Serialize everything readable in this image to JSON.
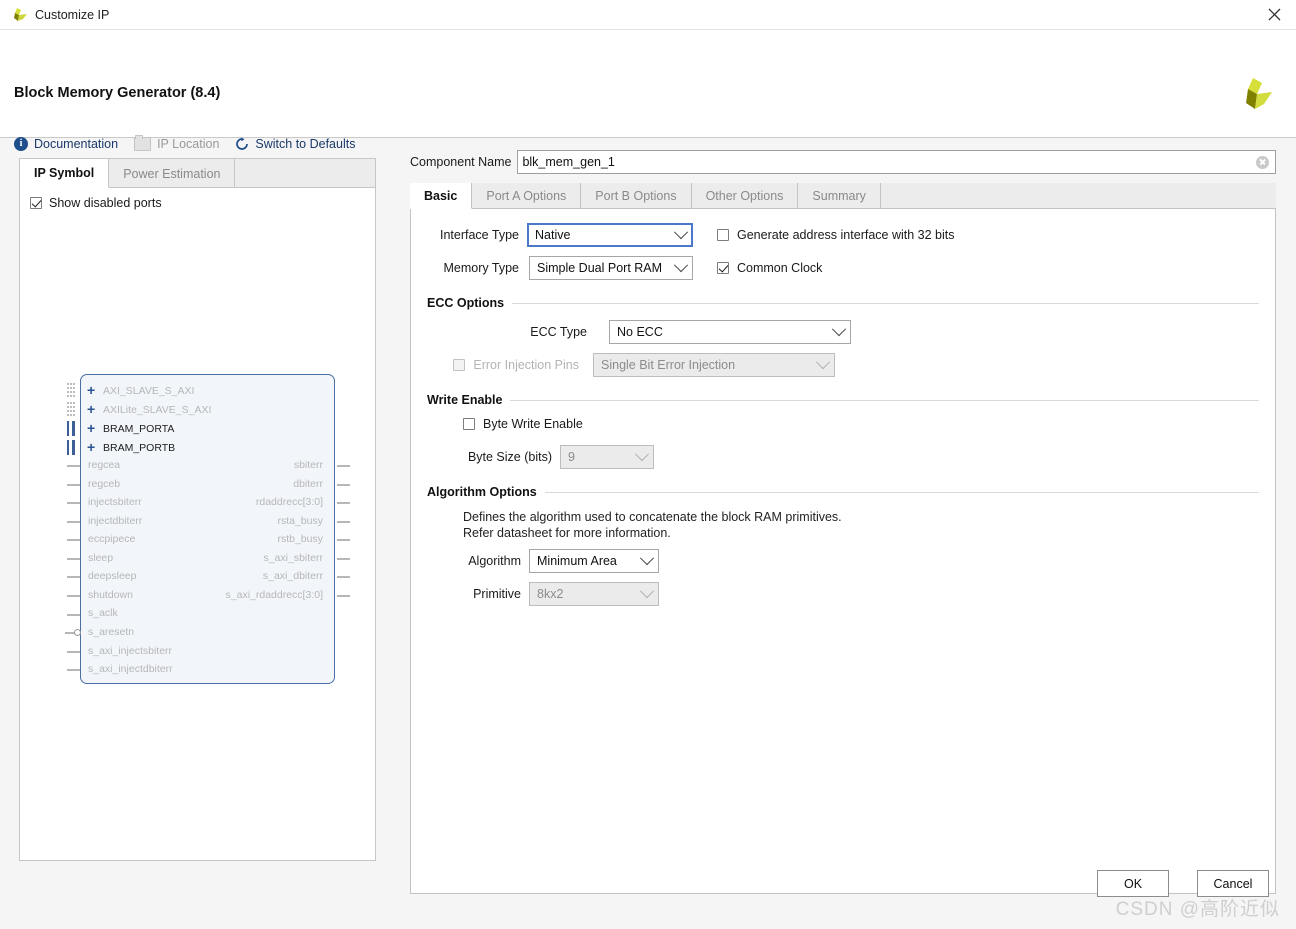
{
  "window": {
    "title": "Customize IP",
    "close_icon": "close-icon",
    "app_icon": "xilinx-logo-icon"
  },
  "header": {
    "title": "Block Memory Generator (8.4)",
    "brand_icon": "xilinx-logo-icon",
    "links": [
      {
        "label": "Documentation",
        "icon": "info-icon",
        "disabled": false
      },
      {
        "label": "IP Location",
        "icon": "folder-icon",
        "disabled": true
      },
      {
        "label": "Switch to Defaults",
        "icon": "refresh-icon",
        "disabled": false
      }
    ]
  },
  "left_panel": {
    "tabs": [
      {
        "label": "IP Symbol",
        "active": true
      },
      {
        "label": "Power Estimation",
        "active": false
      }
    ],
    "show_disabled_ports": {
      "label": "Show disabled ports",
      "checked": true
    },
    "symbol": {
      "buses": [
        {
          "label": "AXI_SLAVE_S_AXI",
          "enabled": false
        },
        {
          "label": "AXILite_SLAVE_S_AXI",
          "enabled": false
        },
        {
          "label": "BRAM_PORTA",
          "enabled": true
        },
        {
          "label": "BRAM_PORTB",
          "enabled": true
        }
      ],
      "inputs": [
        {
          "label": "regcea",
          "enabled": false,
          "negated": false
        },
        {
          "label": "regceb",
          "enabled": false,
          "negated": false
        },
        {
          "label": "injectsbiterr",
          "enabled": false,
          "negated": false
        },
        {
          "label": "injectdbiterr",
          "enabled": false,
          "negated": false
        },
        {
          "label": "eccpipece",
          "enabled": false,
          "negated": false
        },
        {
          "label": "sleep",
          "enabled": false,
          "negated": false
        },
        {
          "label": "deepsleep",
          "enabled": false,
          "negated": false
        },
        {
          "label": "shutdown",
          "enabled": false,
          "negated": false
        },
        {
          "label": "s_aclk",
          "enabled": false,
          "negated": false
        },
        {
          "label": "s_aresetn",
          "enabled": false,
          "negated": true
        },
        {
          "label": "s_axi_injectsbiterr",
          "enabled": false,
          "negated": false
        },
        {
          "label": "s_axi_injectdbiterr",
          "enabled": false,
          "negated": false
        }
      ],
      "outputs": [
        {
          "label": "sbiterr",
          "enabled": false
        },
        {
          "label": "dbiterr",
          "enabled": false
        },
        {
          "label": "rdaddrecc[3:0]",
          "enabled": false
        },
        {
          "label": "rsta_busy",
          "enabled": false
        },
        {
          "label": "rstb_busy",
          "enabled": false
        },
        {
          "label": "s_axi_sbiterr",
          "enabled": false
        },
        {
          "label": "s_axi_dbiterr",
          "enabled": false
        },
        {
          "label": "s_axi_rdaddrecc[3:0]",
          "enabled": false
        }
      ]
    }
  },
  "right_panel": {
    "component_name": {
      "label": "Component Name",
      "value": "blk_mem_gen_1",
      "placeholder": "",
      "clear_icon": "clear-circle-icon"
    },
    "tabs": [
      {
        "label": "Basic",
        "active": true
      },
      {
        "label": "Port A Options",
        "active": false
      },
      {
        "label": "Port B Options",
        "active": false
      },
      {
        "label": "Other Options",
        "active": false
      },
      {
        "label": "Summary",
        "active": false
      }
    ],
    "basic": {
      "interface_type": {
        "label": "Interface Type",
        "value": "Native",
        "focused": true,
        "disabled": false
      },
      "memory_type": {
        "label": "Memory Type",
        "value": "Simple Dual Port RAM",
        "focused": false,
        "disabled": false
      },
      "generate_address_interface": {
        "label": "Generate address interface with 32 bits",
        "checked": false,
        "disabled": false
      },
      "common_clock": {
        "label": "Common Clock",
        "checked": true,
        "disabled": false
      },
      "ecc_options": {
        "title": "ECC Options",
        "ecc_type": {
          "label": "ECC Type",
          "value": "No ECC",
          "disabled": false
        },
        "error_injection_pins": {
          "label": "Error Injection Pins",
          "checked": false,
          "disabled": true,
          "value": "Single Bit Error Injection"
        }
      },
      "write_enable": {
        "title": "Write Enable",
        "byte_write_enable": {
          "label": "Byte Write Enable",
          "checked": false,
          "disabled": false
        },
        "byte_size": {
          "label": "Byte Size (bits)",
          "value": "9",
          "disabled": true
        }
      },
      "algorithm_options": {
        "title": "Algorithm Options",
        "help_line_1": "Defines the algorithm used to concatenate the block RAM primitives.",
        "help_line_2": "Refer datasheet for more information.",
        "algorithm": {
          "label": "Algorithm",
          "value": "Minimum Area",
          "disabled": false
        },
        "primitive": {
          "label": "Primitive",
          "value": "8kx2",
          "disabled": true
        }
      }
    }
  },
  "footer": {
    "ok_label": "OK",
    "cancel_label": "Cancel"
  },
  "watermark": "CSDN @高阶近似",
  "colors": {
    "accent_blue": "#1f4e8c",
    "focus_blue": "#4b78c8",
    "symbol_border": "#4a6fa5",
    "symbol_fill": "#f2f6fb",
    "brand_olive": "#7f8000",
    "brand_yellow": "#d6df3a"
  }
}
